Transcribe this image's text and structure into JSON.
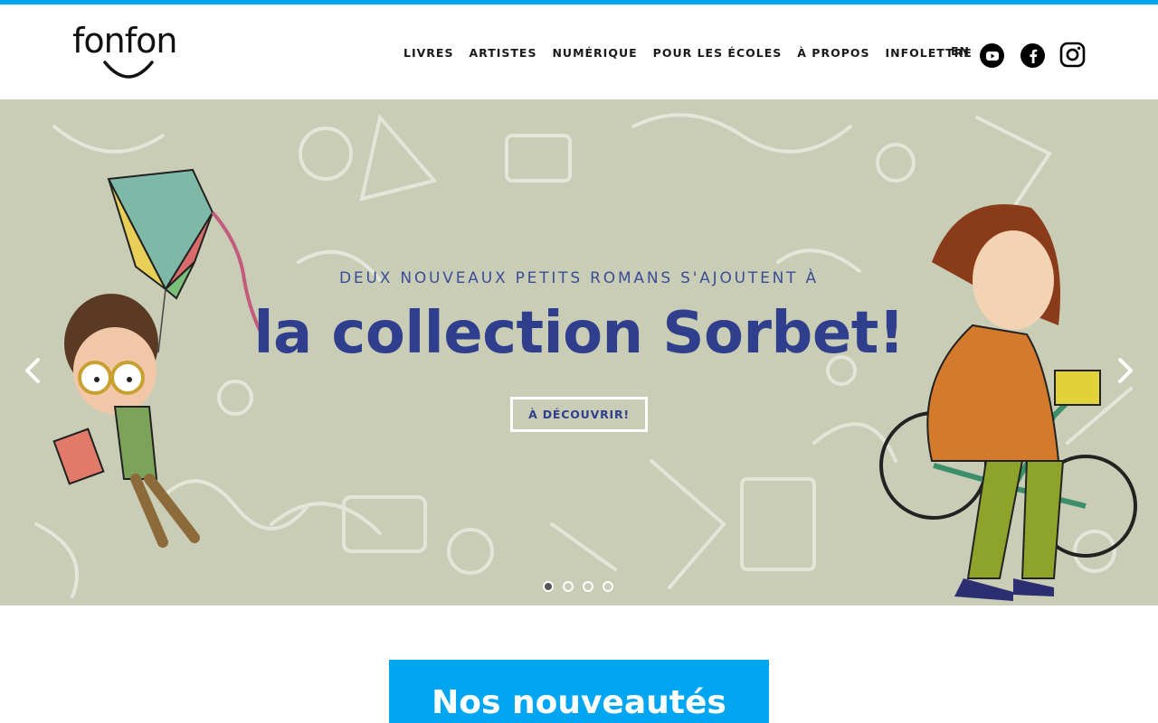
{
  "brand": {
    "logo_text": "fonfon",
    "accent": "#00a6f1",
    "title_color": "#2f3f8d"
  },
  "nav": {
    "items": [
      {
        "label": "LIVRES"
      },
      {
        "label": "ARTISTES"
      },
      {
        "label": "NUMÉRIQUE"
      },
      {
        "label": "POUR LES ÉCOLES"
      },
      {
        "label": "À PROPOS"
      },
      {
        "label": "INFOLETTRE"
      }
    ],
    "lang": "EN",
    "social": [
      "youtube-icon",
      "facebook-icon",
      "instagram-icon"
    ]
  },
  "hero": {
    "subtitle": "DEUX NOUVEAUX PETITS ROMANS S'AJOUTENT À",
    "title": "la collection Sorbet!",
    "button": "À DÉCOUVRIR!",
    "slides": 4,
    "active_slide": 1
  },
  "section": {
    "title": "Nos nouveautés"
  }
}
